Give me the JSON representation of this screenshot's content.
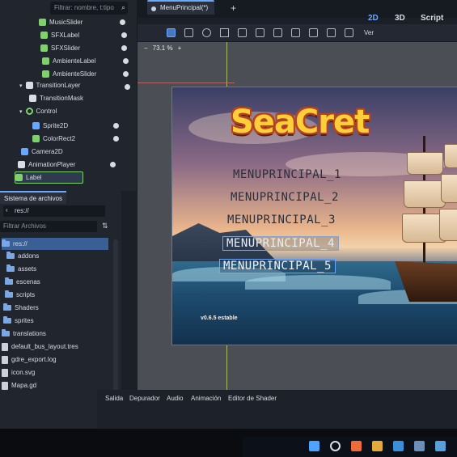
{
  "scene_tree": {
    "filter_placeholder": "Filtrar: nombre, t:tipo",
    "items": [
      {
        "label": "MusicSlider"
      },
      {
        "label": "SFXLabel"
      },
      {
        "label": "SFXSlider"
      },
      {
        "label": "AmbienteLabel"
      },
      {
        "label": "AmbienteSlider"
      },
      {
        "label": "TransitionLayer"
      },
      {
        "label": "TransitionMask"
      },
      {
        "label": "Control"
      },
      {
        "label": "Sprite2D"
      },
      {
        "label": "ColorRect2"
      },
      {
        "label": "Camera2D"
      },
      {
        "label": "AnimationPlayer"
      },
      {
        "label": "Label"
      }
    ]
  },
  "filesystem": {
    "tab_label": "Sistema de archivos",
    "path": "res://",
    "filter_placeholder": "Filtrar Archivos",
    "items": [
      {
        "label": "res://",
        "kind": "folder"
      },
      {
        "label": "addons",
        "kind": "folder"
      },
      {
        "label": "assets",
        "kind": "folder"
      },
      {
        "label": "escenas",
        "kind": "folder"
      },
      {
        "label": "scripts",
        "kind": "folder"
      },
      {
        "label": "Shaders",
        "kind": "folder"
      },
      {
        "label": "sprites",
        "kind": "folder"
      },
      {
        "label": "translations",
        "kind": "folder"
      },
      {
        "label": "default_bus_layout.tres",
        "kind": "file"
      },
      {
        "label": "gdre_export.log",
        "kind": "file"
      },
      {
        "label": "icon.svg",
        "kind": "file"
      },
      {
        "label": "Mapa.gd",
        "kind": "file"
      }
    ]
  },
  "editor": {
    "scene_tab": "MenuPrincipal(*)",
    "modes": {
      "two_d": "2D",
      "three_d": "3D",
      "script": "Script"
    },
    "zoom": "73.1 %",
    "view_label": "Ver"
  },
  "game": {
    "logo": "SeaCret",
    "menu": [
      "MENUPRINCIPAL_1",
      "MENUPRINCIPAL_2",
      "MENUPRINCIPAL_3",
      "MENUPRINCIPAL_4",
      "MENUPRINCIPAL_5"
    ],
    "version": "v0.6.5 estable"
  },
  "bottom_tabs": [
    "Salida",
    "Depurador",
    "Audio",
    "Animación",
    "Editor de Shader"
  ],
  "colors": {
    "accent": "#6aa8ff",
    "node_green": "#7fd16b",
    "logo_yellow": "#ffcf3a"
  }
}
